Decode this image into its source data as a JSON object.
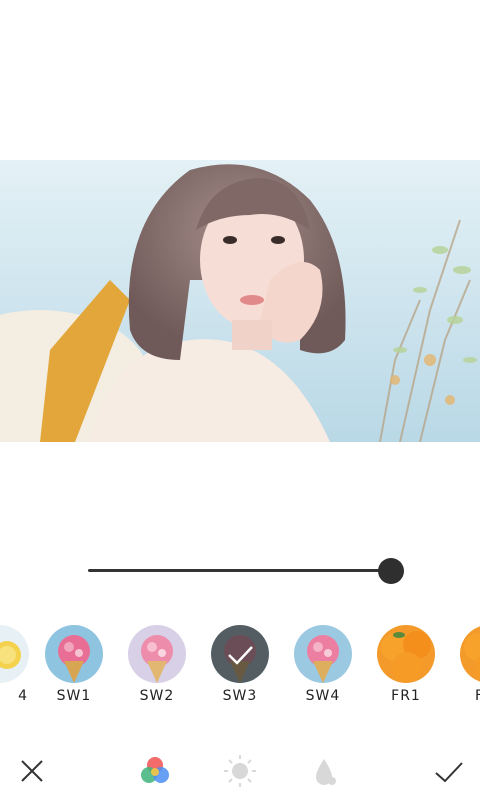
{
  "filters": [
    {
      "label": "4",
      "kind": "lemon"
    },
    {
      "label": "SW1",
      "kind": "icecream-blue"
    },
    {
      "label": "SW2",
      "kind": "icecream-pink"
    },
    {
      "label": "SW3",
      "kind": "selected"
    },
    {
      "label": "SW4",
      "kind": "icecream-blue"
    },
    {
      "label": "FR1",
      "kind": "orange"
    },
    {
      "label": "F",
      "kind": "orange"
    }
  ],
  "slider": {
    "value_fraction": 1.0
  },
  "toolbar": {
    "cancel_icon": "close-icon",
    "filter_icon": "color-circles-icon",
    "brightness_icon": "sun-icon",
    "blur_icon": "drop-icon",
    "confirm_icon": "check-icon"
  },
  "colors": {
    "accent_dark": "#2f2f2f",
    "text": "#222222"
  }
}
